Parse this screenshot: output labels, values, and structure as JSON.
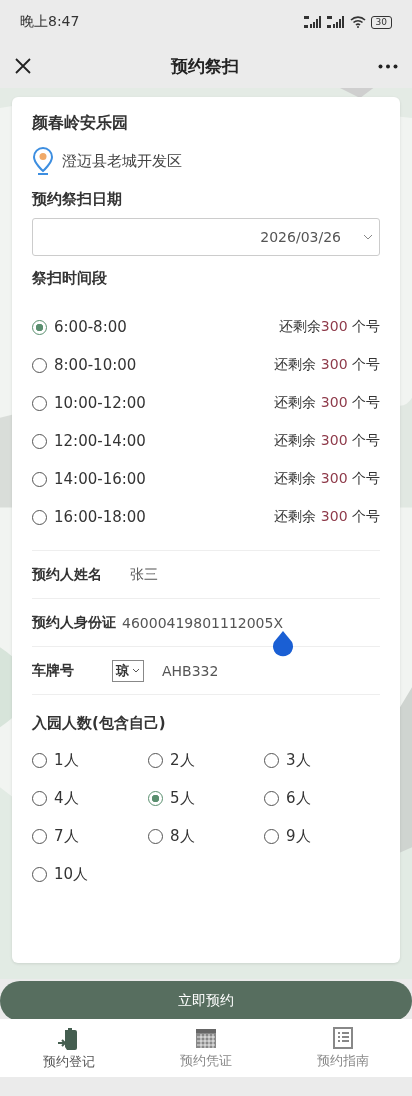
{
  "status_bar": {
    "time": "晚上8:47",
    "battery": "30"
  },
  "nav": {
    "title": "预约祭扫"
  },
  "cemetery": {
    "name": "颜春岭安乐园",
    "address": "澄迈县老城开发区"
  },
  "date": {
    "label": "预约祭扫日期",
    "value": "2026/03/26"
  },
  "slots_label": "祭扫时间段",
  "slots": [
    {
      "time": "6:00-8:00",
      "prefix": "还剩余",
      "count": "300",
      "suffix": " 个号",
      "selected": true
    },
    {
      "time": "8:00-10:00",
      "prefix": "还剩余 ",
      "count": "300",
      "suffix": " 个号",
      "selected": false
    },
    {
      "time": "10:00-12:00",
      "prefix": "还剩余 ",
      "count": "300",
      "suffix": " 个号",
      "selected": false
    },
    {
      "time": "12:00-14:00",
      "prefix": "还剩余 ",
      "count": "300",
      "suffix": " 个号",
      "selected": false
    },
    {
      "time": "14:00-16:00",
      "prefix": "还剩余 ",
      "count": "300",
      "suffix": " 个号",
      "selected": false
    },
    {
      "time": "16:00-18:00",
      "prefix": "还剩余 ",
      "count": "300",
      "suffix": " 个号",
      "selected": false
    }
  ],
  "fields": [
    {
      "kind": "text",
      "label": "预约人姓名",
      "value": "张三"
    },
    {
      "kind": "id",
      "label": "预约人身份证",
      "value": "46000419801112005X"
    },
    {
      "kind": "plate",
      "label": "车牌号",
      "province": "琼",
      "value": "AHB332"
    }
  ],
  "people_label": "入园人数(包含自己)",
  "people": [
    {
      "label": "1人",
      "selected": false
    },
    {
      "label": "2人",
      "selected": false
    },
    {
      "label": "3人",
      "selected": false
    },
    {
      "label": "4人",
      "selected": false
    },
    {
      "label": "5人",
      "selected": true
    },
    {
      "label": "6人",
      "selected": false
    },
    {
      "label": "7人",
      "selected": false
    },
    {
      "label": "8人",
      "selected": false
    },
    {
      "label": "9人",
      "selected": false
    },
    {
      "label": "10人",
      "selected": false
    }
  ],
  "submit": "立即预约",
  "tabs": [
    {
      "kind": "register",
      "label": "预约登记",
      "selected": true
    },
    {
      "kind": "voucher",
      "label": "预约凭证",
      "selected": false
    },
    {
      "kind": "guide",
      "label": "预约指南",
      "selected": false
    }
  ]
}
